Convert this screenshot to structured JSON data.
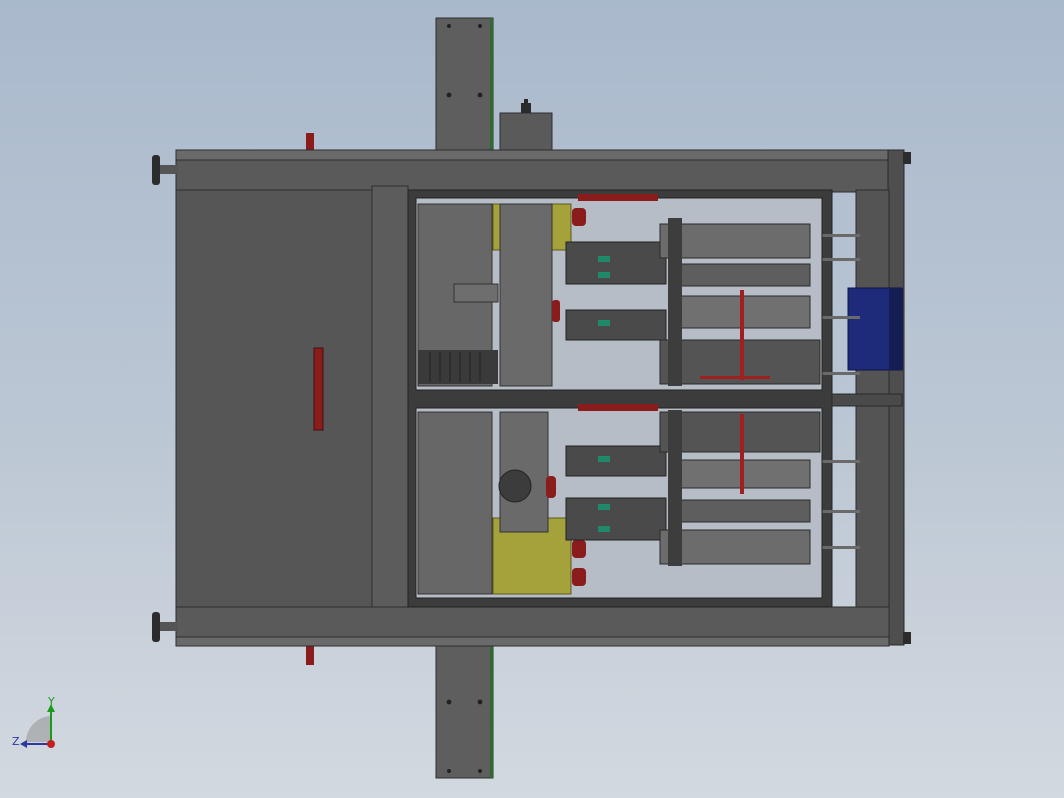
{
  "viewport": {
    "background_top": "#a9b9cc",
    "background_bottom": "#d3d9e0"
  },
  "model": {
    "description_icon": "cad-assembly-top-view",
    "colors": {
      "frame": "#5b5b5b",
      "frame_dark": "#3f3f3f",
      "window_bg": "#b7bdc6",
      "cylinder": "#4a4a4a",
      "red_part": "#8a1c1c",
      "olive_block": "#a5a23c",
      "blue_motor": "#1e2a7a",
      "teal_band": "#1f8a6a"
    }
  },
  "triad": {
    "y_label": "Y",
    "z_label": "Z",
    "y_color": "#1a9a1a",
    "z_color": "#2a3aa0",
    "x_color": "#c41e1e"
  }
}
